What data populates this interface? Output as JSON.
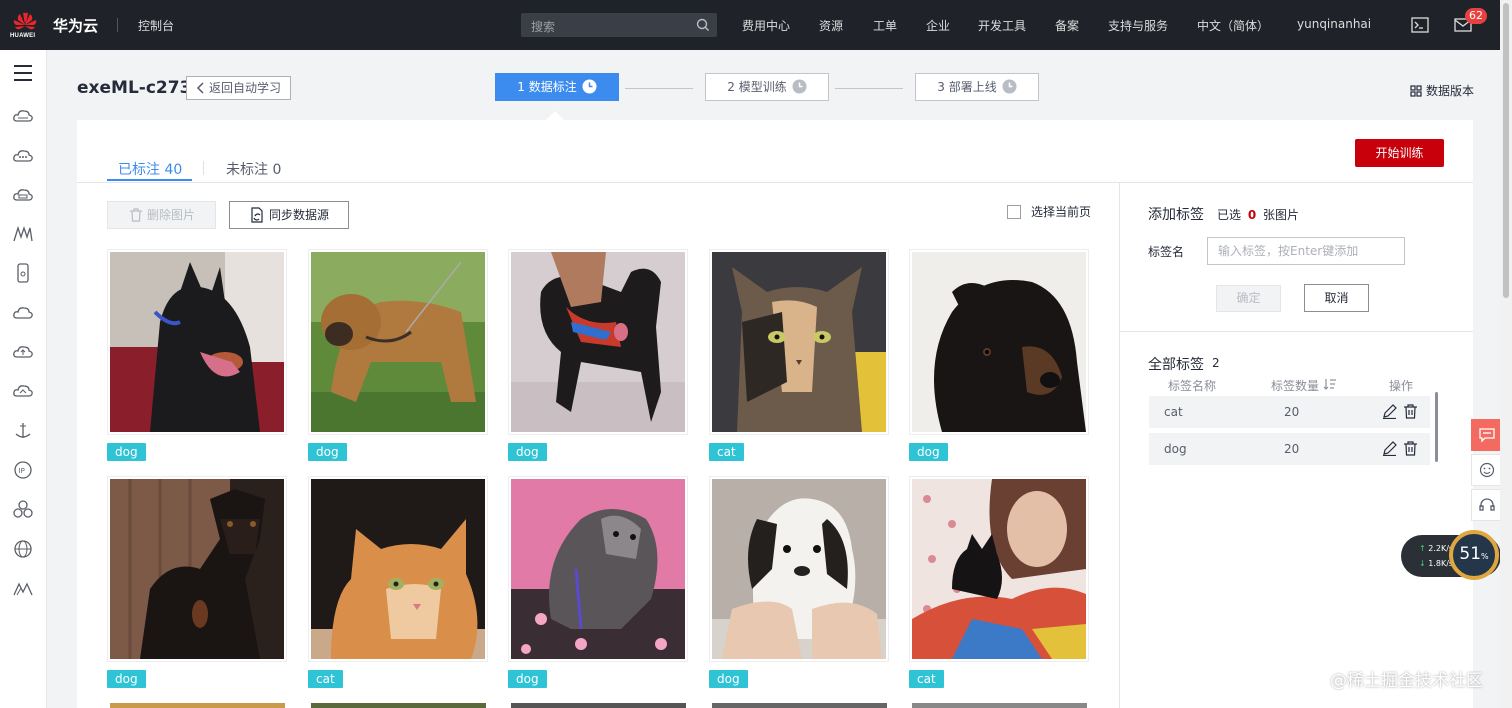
{
  "topbar": {
    "logo_text": "HUAWEI",
    "brand": "华为云",
    "console": "控制台",
    "search_placeholder": "搜索",
    "nav": [
      "费用中心",
      "资源",
      "工单",
      "企业",
      "开发工具",
      "备案",
      "支持与服务",
      "中文（简体）",
      "yunqinanhai"
    ],
    "message_count": "62"
  },
  "project": {
    "title": "exeML-c273",
    "back_label": "返回自动学习",
    "version_label": "数据版本"
  },
  "steps": [
    {
      "label": "1 数据标注",
      "active": true
    },
    {
      "label": "2 模型训练",
      "active": false
    },
    {
      "label": "3 部署上线",
      "active": false
    }
  ],
  "tabs": {
    "labeled": "已标注 40",
    "unlabeled": "未标注 0"
  },
  "toolbar": {
    "start_training": "开始训练",
    "delete_images": "删除图片",
    "sync_source": "同步数据源",
    "select_page": "选择当前页"
  },
  "images": [
    {
      "label": "dog",
      "subject": "doberman-on-red-couch"
    },
    {
      "label": "dog",
      "subject": "brown-dog-on-grass"
    },
    {
      "label": "dog",
      "subject": "black-dog-with-leash"
    },
    {
      "label": "cat",
      "subject": "tortoiseshell-cat"
    },
    {
      "label": "dog",
      "subject": "rottweiler-puppy"
    },
    {
      "label": "dog",
      "subject": "black-tan-dog-by-fence"
    },
    {
      "label": "cat",
      "subject": "orange-tabby-cat"
    },
    {
      "label": "dog",
      "subject": "grey-terrier-on-pillow"
    },
    {
      "label": "dog",
      "subject": "puppy-held-in-hands"
    },
    {
      "label": "cat",
      "subject": "girl-with-black-kitten"
    }
  ],
  "add_label": {
    "title": "添加标签",
    "selected_prefix": "已选",
    "selected_count": "0",
    "selected_suffix": "张图片",
    "field_label": "标签名",
    "placeholder": "输入标签，按Enter键添加",
    "ok": "确定",
    "cancel": "取消"
  },
  "all_labels": {
    "title": "全部标签",
    "count": "2",
    "columns": [
      "标签名称",
      "标签数量",
      "操作"
    ],
    "rows": [
      {
        "name": "cat",
        "count": "20"
      },
      {
        "name": "dog",
        "count": "20"
      }
    ]
  },
  "net_speed": {
    "up": "2.2K/s",
    "down": "1.8K/s",
    "percent": "51",
    "unit": "%"
  },
  "watermark": "@稀土掘金技术社区",
  "colors": {
    "topbar": "#1f2329",
    "accent": "#3c8cf0",
    "primary_red": "#c7000b",
    "tag": "#2fc3d6"
  }
}
